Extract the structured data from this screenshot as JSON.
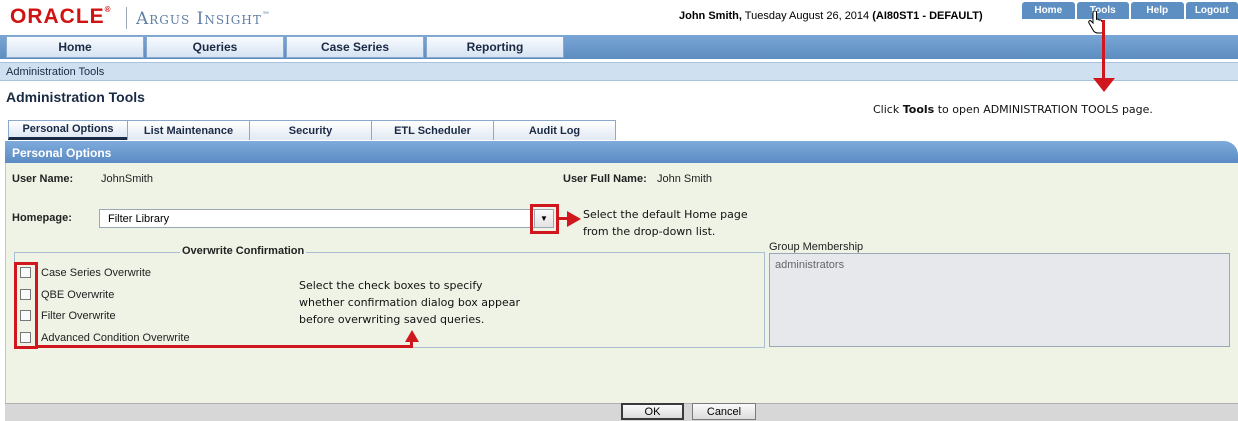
{
  "header": {
    "oracle": "ORACLE",
    "oracle_reg": "®",
    "product": "Argus Insight",
    "product_tm": "™",
    "user_name": "John Smith,",
    "date": " Tuesday August 26, 2014 ",
    "session": "(AI80ST1 - DEFAULT)"
  },
  "toplinks": [
    "Home",
    "Tools",
    "Help",
    "Logout"
  ],
  "nav": [
    "Home",
    "Queries",
    "Case Series",
    "Reporting"
  ],
  "breadcrumb": "Administration Tools",
  "page_title": "Administration Tools",
  "tabs": [
    "Personal Options",
    "List Maintenance",
    "Security",
    "ETL Scheduler",
    "Audit Log"
  ],
  "section_title": "Personal Options",
  "form": {
    "user_name_label": "User Name:",
    "user_name_value": "JohnSmith",
    "full_name_label": "User Full Name:",
    "full_name_value": "John Smith",
    "homepage_label": "Homepage:",
    "homepage_value": "Filter Library",
    "overwrite_legend": "Overwrite Confirmation",
    "checkboxes": [
      "Case Series Overwrite",
      "QBE Overwrite",
      "Filter Overwrite",
      "Advanced Condition Overwrite"
    ],
    "group_label": "Group Membership",
    "group_value": "administrators"
  },
  "buttons": {
    "ok": "OK",
    "cancel": "Cancel"
  },
  "annotations": {
    "tools_prefix": "Click ",
    "tools_bold": "Tools",
    "tools_suffix": " to open ADMINISTRATION TOOLS page.",
    "homepage_line1": "Select the default Home page",
    "homepage_line2": "from the drop-down list.",
    "checkbox_line1": "Select the check boxes to specify",
    "checkbox_line2": "whether confirmation dialog box appear",
    "checkbox_line3": "before overwriting saved queries."
  },
  "colors": {
    "annotation_red": "#d0171e",
    "oracle_red": "#d01212",
    "nav_blue": "#5e8fc3"
  }
}
